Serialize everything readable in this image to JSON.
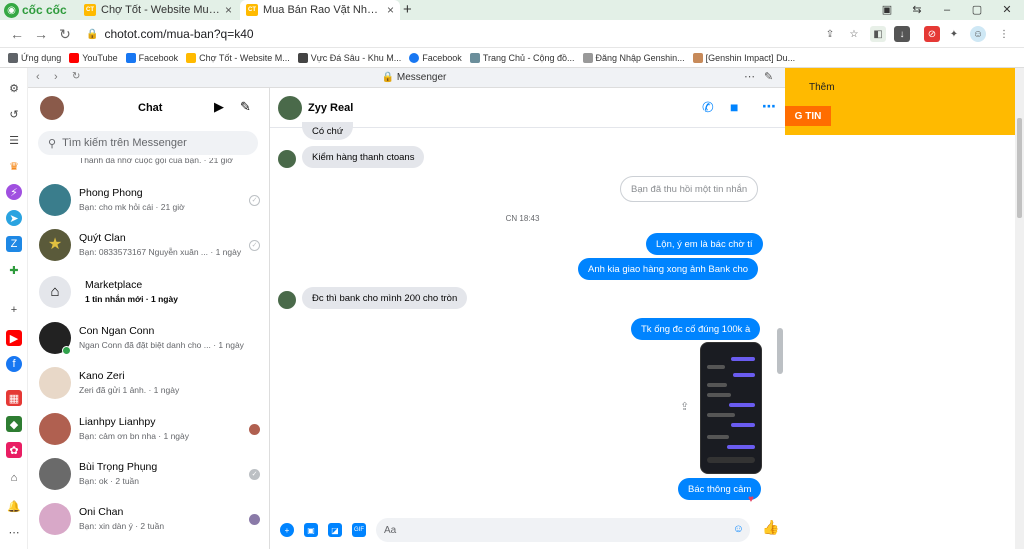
{
  "browser": {
    "brand": "cốc cốc",
    "tabs": [
      {
        "title": "Chợ Tốt - Website Mua Bán",
        "favicon": "CT",
        "active": false
      },
      {
        "title": "Mua Bán Rao Vặt Nhanh Chó",
        "favicon": "CT",
        "active": true
      }
    ],
    "url": "chotot.com/mua-ban?q=k40",
    "bookmarks": [
      {
        "label": "Ứng dụng",
        "color": "#5f6368"
      },
      {
        "label": "YouTube",
        "color": "#ff0000"
      },
      {
        "label": "Facebook",
        "color": "#1877f2"
      },
      {
        "label": "Chợ Tốt - Website M...",
        "color": "#ffba00"
      },
      {
        "label": "Vực Đá Sâu - Khu M...",
        "color": "#444"
      },
      {
        "label": "Facebook",
        "color": "#1877f2"
      },
      {
        "label": "Trang Chủ - Cộng đồ...",
        "color": "#6b8e9b"
      },
      {
        "label": "Đăng Nhập Genshin...",
        "color": "#999"
      },
      {
        "label": "[Genshin Impact] Du...",
        "color": "#c78a5a"
      }
    ]
  },
  "messenger": {
    "panel_title": "Messenger",
    "chat_header": "Chat",
    "search_placeholder": "Tìm kiếm trên Messenger",
    "partial_preview": "Thành đã nhỡ cuộc gọi của bạn. · 21 giờ",
    "chats": [
      {
        "name": "Phong Phong",
        "preview": "Bạn: cho mk hỏi cái · 21 giờ",
        "status": "seen",
        "avatar_color": "#3a7d8c"
      },
      {
        "name": "Quýt Clan",
        "preview": "Bạn: 0833573167 Nguyễn xuân ... · 1 ngày",
        "status": "seen",
        "avatar_color": "#5a5a3a"
      },
      {
        "name": "Marketplace",
        "preview": "1 tin nhắn mới · 1 ngày",
        "status": "none",
        "avatar_color": "#e4e6eb",
        "bold": true
      },
      {
        "name": "Con Ngan Conn",
        "preview": "Ngan Conn đã đặt biệt danh cho ... · 1 ngày",
        "status": "online",
        "avatar_color": "#222"
      },
      {
        "name": "Kano Zeri",
        "preview": "Zeri đã gửi 1 ảnh. · 1 ngày",
        "status": "none",
        "avatar_color": "#e8d8c8"
      },
      {
        "name": "Lianhpy Lianhpy",
        "preview": "Bạn: cảm ơn bn nha · 1 ngày",
        "status": "avatar",
        "avatar_color": "#b06050"
      },
      {
        "name": "Bùi Trọng Phụng",
        "preview": "Bạn: ok · 2 tuần",
        "status": "seen",
        "avatar_color": "#6a6a6a"
      },
      {
        "name": "Oni Chan",
        "preview": "Bạn: xin dàn ý · 2 tuần",
        "status": "avatar",
        "avatar_color": "#d8a8c8"
      }
    ],
    "conversation": {
      "name": "Zyy Real",
      "messages": [
        {
          "type": "in",
          "text": "Có chứ"
        },
        {
          "type": "in",
          "text": "Kiểm hàng thanh ctoans"
        },
        {
          "type": "deleted",
          "text": "Bạn đã thu hồi một tin nhắn"
        },
        {
          "type": "timestamp",
          "text": "CN 18:43"
        },
        {
          "type": "out",
          "text": "Lộn, ý em là bác chờ tí"
        },
        {
          "type": "out",
          "text": "Anh kia giao hàng xong ảnh Bank cho"
        },
        {
          "type": "in",
          "text": "Đc thì bank cho mình 200 cho tròn"
        },
        {
          "type": "out",
          "text": "Tk ống đc cố đúng 100k à"
        },
        {
          "type": "image",
          "text": ""
        },
        {
          "type": "out",
          "text": "Bác thông cảm"
        }
      ],
      "composer_placeholder": "Aa"
    }
  },
  "page_behind": {
    "them_label": "Thêm",
    "button_partial": "G TIN"
  }
}
